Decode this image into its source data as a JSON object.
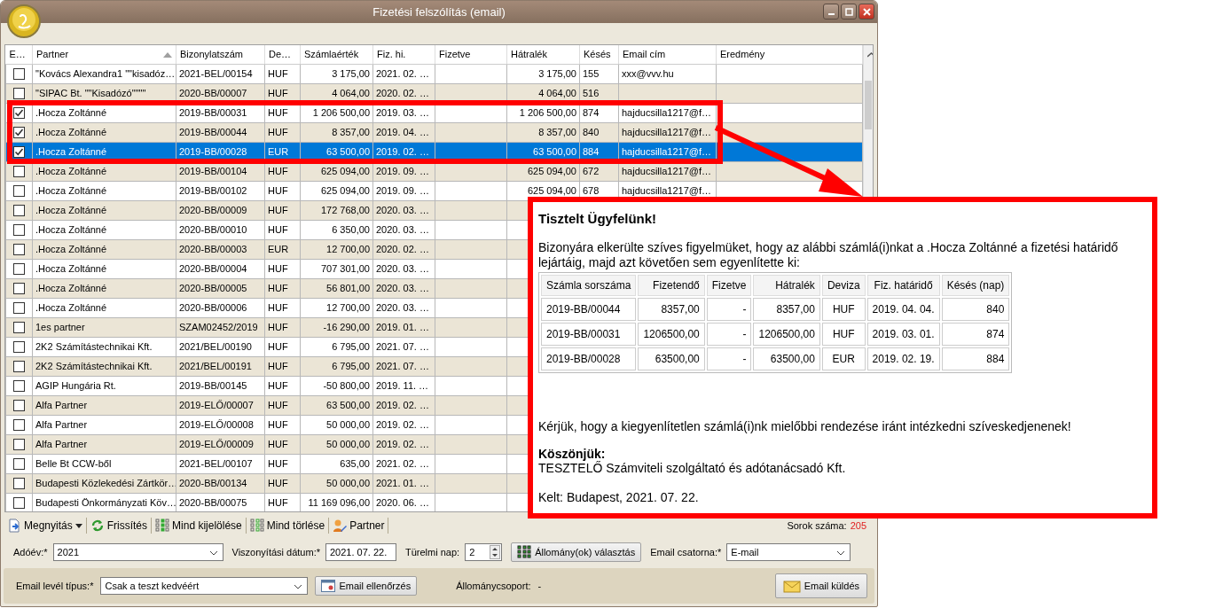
{
  "window": {
    "title": "Fizetési felszólítás (email)"
  },
  "table": {
    "columns": [
      {
        "label": "E…",
        "sorted": false
      },
      {
        "label": "Partner",
        "sorted": true
      },
      {
        "label": "Bizonylatszám",
        "sorted": false
      },
      {
        "label": "De…",
        "sorted": false
      },
      {
        "label": "Számlaérték",
        "sorted": false
      },
      {
        "label": "Fiz. hi.",
        "sorted": false
      },
      {
        "label": "Fizetve",
        "sorted": false
      },
      {
        "label": "Hátralék",
        "sorted": false
      },
      {
        "label": "Késés",
        "sorted": false
      },
      {
        "label": "Email cím",
        "sorted": false
      },
      {
        "label": "Eredmény",
        "sorted": false
      }
    ],
    "rows": [
      {
        "checked": false,
        "selected": false,
        "partner": "\"Kovács Alexandra1 \"\"kisadóz…",
        "number": "2021-BEL/00154",
        "currency": "HUF",
        "amount": "3 175,00",
        "due": "2021. 02. …",
        "remaining": "3 175,00",
        "delay": "155",
        "email": "xxx@vvv.hu"
      },
      {
        "checked": false,
        "selected": false,
        "partner": "\"SIPAC Bt. \"\"Kisadózó\"\"\"\"",
        "number": "2020-BB/00007",
        "currency": "HUF",
        "amount": "4 064,00",
        "due": "2020. 02. …",
        "remaining": "4 064,00",
        "delay": "516"
      },
      {
        "checked": true,
        "selected": false,
        "partner": ".Hocza Zoltánné",
        "number": "2019-BB/00031",
        "currency": "HUF",
        "amount": "1 206 500,00",
        "due": "2019. 03. …",
        "remaining": "1 206 500,00",
        "delay": "874",
        "email": "hajducsilla1217@f…"
      },
      {
        "checked": true,
        "selected": false,
        "partner": ".Hocza Zoltánné",
        "number": "2019-BB/00044",
        "currency": "HUF",
        "amount": "8 357,00",
        "due": "2019. 04. …",
        "remaining": "8 357,00",
        "delay": "840",
        "email": "hajducsilla1217@f…"
      },
      {
        "checked": true,
        "selected": true,
        "partner": ".Hocza Zoltánné",
        "number": "2019-BB/00028",
        "currency": "EUR",
        "amount": "63 500,00",
        "due": "2019. 02. …",
        "remaining": "63 500,00",
        "delay": "884",
        "email": "hajducsilla1217@f…"
      },
      {
        "checked": false,
        "selected": false,
        "partner": ".Hocza Zoltánné",
        "number": "2019-BB/00104",
        "currency": "HUF",
        "amount": "625 094,00",
        "due": "2019. 09. …",
        "remaining": "625 094,00",
        "delay": "672",
        "email": "hajducsilla1217@f…"
      },
      {
        "checked": false,
        "selected": false,
        "partner": ".Hocza Zoltánné",
        "number": "2019-BB/00102",
        "currency": "HUF",
        "amount": "625 094,00",
        "due": "2019. 09. …",
        "remaining": "625 094,00",
        "delay": "678",
        "email": "hajducsilla1217@f…"
      },
      {
        "checked": false,
        "selected": false,
        "partner": ".Hocza Zoltánné",
        "number": "2020-BB/00009",
        "currency": "HUF",
        "amount": "172 768,00",
        "due": "2020. 03. …"
      },
      {
        "checked": false,
        "selected": false,
        "partner": ".Hocza Zoltánné",
        "number": "2020-BB/00010",
        "currency": "HUF",
        "amount": "6 350,00",
        "due": "2020. 03. …"
      },
      {
        "checked": false,
        "selected": false,
        "partner": ".Hocza Zoltánné",
        "number": "2020-BB/00003",
        "currency": "EUR",
        "amount": "12 700,00",
        "due": "2020. 02. …"
      },
      {
        "checked": false,
        "selected": false,
        "partner": ".Hocza Zoltánné",
        "number": "2020-BB/00004",
        "currency": "HUF",
        "amount": "707 301,00",
        "due": "2020. 03. …"
      },
      {
        "checked": false,
        "selected": false,
        "partner": ".Hocza Zoltánné",
        "number": "2020-BB/00005",
        "currency": "HUF",
        "amount": "56 801,00",
        "due": "2020. 03. …"
      },
      {
        "checked": false,
        "selected": false,
        "partner": ".Hocza Zoltánné",
        "number": "2020-BB/00006",
        "currency": "HUF",
        "amount": "12 700,00",
        "due": "2020. 03. …"
      },
      {
        "checked": false,
        "selected": false,
        "partner": "1es partner",
        "number": "SZAM02452/2019",
        "currency": "HUF",
        "amount": "-16 290,00",
        "due": "2019. 01. …"
      },
      {
        "checked": false,
        "selected": false,
        "partner": "2K2 Számítástechnikai Kft.",
        "number": "2021/BEL/00190",
        "currency": "HUF",
        "amount": "6 795,00",
        "due": "2021. 07. …"
      },
      {
        "checked": false,
        "selected": false,
        "partner": "2K2 Számítástechnikai Kft.",
        "number": "2021/BEL/00191",
        "currency": "HUF",
        "amount": "6 795,00",
        "due": "2021. 07. …"
      },
      {
        "checked": false,
        "selected": false,
        "partner": "AGIP Hungária Rt.",
        "number": "2019-BB/00145",
        "currency": "HUF",
        "amount": "-50 800,00",
        "due": "2019. 11. …"
      },
      {
        "checked": false,
        "selected": false,
        "partner": "Alfa Partner",
        "number": "2019-ELŐ/00007",
        "currency": "HUF",
        "amount": "63 500,00",
        "due": "2019. 02. …"
      },
      {
        "checked": false,
        "selected": false,
        "partner": "Alfa Partner",
        "number": "2019-ELŐ/00008",
        "currency": "HUF",
        "amount": "50 000,00",
        "due": "2019. 02. …"
      },
      {
        "checked": false,
        "selected": false,
        "partner": "Alfa Partner",
        "number": "2019-ELŐ/00009",
        "currency": "HUF",
        "amount": "50 000,00",
        "due": "2019. 02. …"
      },
      {
        "checked": false,
        "selected": false,
        "partner": "Belle Bt CCW-ből",
        "number": "2021-BEL/00107",
        "currency": "HUF",
        "amount": "635,00",
        "due": "2021. 02. …"
      },
      {
        "checked": false,
        "selected": false,
        "partner": "Budapesti Közlekedési Zártkör…",
        "number": "2020-BB/00134",
        "currency": "HUF",
        "amount": "50 000,00",
        "due": "2021. 01. …"
      },
      {
        "checked": false,
        "selected": false,
        "partner": "Budapesti Önkormányzati Köv…",
        "number": "2020-BB/00075",
        "currency": "HUF",
        "amount": "11 169 096,00",
        "due": "2020. 06. …"
      }
    ]
  },
  "toolbar": [
    {
      "kind": "open",
      "label": "Megnyitás",
      "dropdown": true
    },
    {
      "kind": "refresh",
      "label": "Frissítés",
      "dropdown": false
    },
    {
      "kind": "selectall",
      "label": "Mind kijelölése",
      "dropdown": false
    },
    {
      "kind": "clearall",
      "label": "Mind törlése",
      "dropdown": false
    },
    {
      "kind": "partner",
      "label": "Partner",
      "dropdown": false
    }
  ],
  "row_count": {
    "label": "Sorok száma:",
    "value": "205"
  },
  "filters": {
    "year": {
      "label": "Adóév:*",
      "value": "2021"
    },
    "ref_date": {
      "label": "Viszonyítási dátum:*",
      "value": "2021. 07. 22."
    },
    "grace_days": {
      "label": "Türelmi nap:",
      "value": "2"
    },
    "select_files_button": "Állomány(ok) választás",
    "channel": {
      "label": "Email csatorna:*",
      "value": "E-mail"
    }
  },
  "email_bar": {
    "type": {
      "label": "Email levél típus:*",
      "value": "Csak a teszt kedvéért"
    },
    "check_button": "Email ellenőrzés",
    "file_group": {
      "label": "Állománycsoport:",
      "value": "-"
    },
    "send_button": "Email küldés"
  },
  "email_preview": {
    "greeting": "Tisztelt Ügyfelünk!",
    "intro": "Bizonyára elkerülte szíves figyelmüket, hogy az alábbi számlá(i)nkat a .Hocza Zoltánné a fizetési határidő lejártáig, majd azt követően sem egyenlítette ki:",
    "table": {
      "columns": [
        "Számla sorszáma",
        "Fizetendő",
        "Fizetve",
        "Hátralék",
        "Deviza",
        "Fiz. határidő",
        "Késés (nap)"
      ],
      "rows": [
        [
          "2019-BB/00044",
          "8357,00",
          "-",
          "8357,00",
          "HUF",
          "2019. 04. 04.",
          "840"
        ],
        [
          "2019-BB/00031",
          "1206500,00",
          "-",
          "1206500,00",
          "HUF",
          "2019. 03. 01.",
          "874"
        ],
        [
          "2019-BB/00028",
          "63500,00",
          "-",
          "63500,00",
          "EUR",
          "2019. 02. 19.",
          "884"
        ]
      ]
    },
    "request": "Kérjük, hogy a kiegyenlítetlen számlá(i)nk mielőbbi rendezése iránt intézkedni szíveskedjenenek!",
    "thanks": "Köszönjük:",
    "sender": "TESZTELŐ Számviteli szolgáltató és adótanácsadó Kft.",
    "dated": "Kelt: Budapest, 2021. 07. 22."
  }
}
